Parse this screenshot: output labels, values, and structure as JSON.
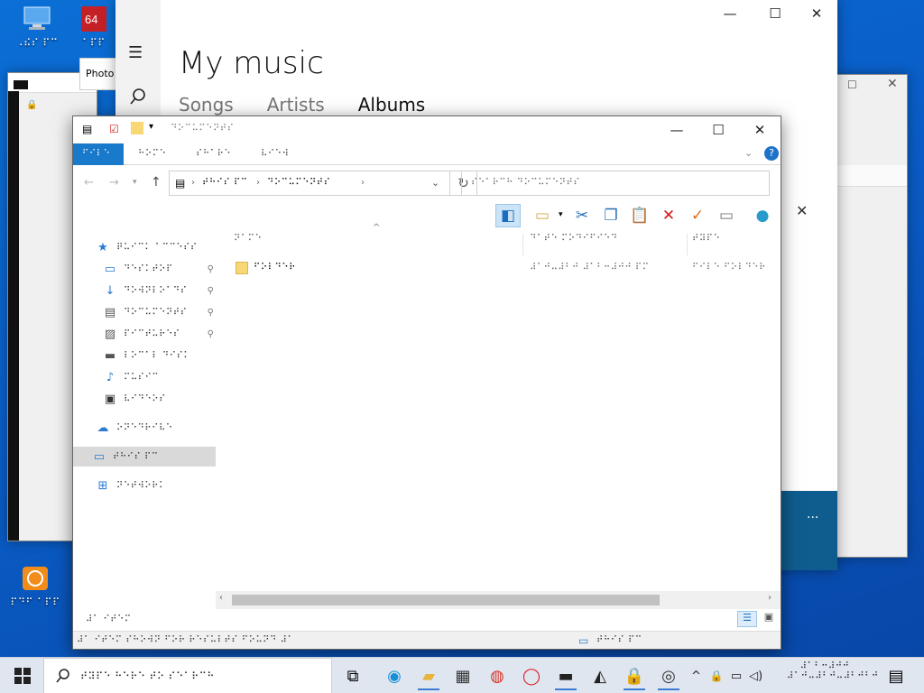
{
  "desktop": {
    "icons": [
      {
        "name": "this-pc",
        "label": "⠠⠮⠎ ⠏⠉"
      },
      {
        "name": "app-64",
        "label": "⠁⠏⠏"
      },
      {
        "name": "pdf-app",
        "label": "⠏⠙⠋ ⠁⠏⠏"
      }
    ]
  },
  "back_window_left": {
    "title": "Photo",
    "label": "⠏⠓⠕⠞⠕",
    "bottom": "⠼⠁ ⠊⠞"
  },
  "music_app": {
    "title": "My music",
    "tabs": [
      {
        "label": "Songs",
        "selected": false
      },
      {
        "label": "Artists",
        "selected": false
      },
      {
        "label": "Albums",
        "selected": true
      }
    ],
    "more_label": "···"
  },
  "explorer": {
    "title": "⠙⠕⠉⠥⠍⠑⠝⠞⠎",
    "ribbon_tabs": [
      "⠋⠊⠇⠑",
      "⠓⠕⠍⠑",
      "⠎⠓⠁⠗⠑",
      "⠧⠊⠑⠺"
    ],
    "address_parts": [
      "⠞⠓⠊⠎ ⠏⠉",
      "⠙⠕⠉⠥⠍⠑⠝⠞⠎"
    ],
    "search_placeholder": "⠎⠑⠁⠗⠉⠓ ⠙⠕⠉⠥⠍⠑⠝⠞⠎",
    "nav_items": [
      {
        "name": "quick-access",
        "icon": "★",
        "label": "⠟⠥⠊⠉⠅ ⠁⠉⠉⠑⠎⠎",
        "pinned": false
      },
      {
        "name": "desktop",
        "icon": "▭",
        "label": "⠙⠑⠎⠅⠞⠕⠏",
        "pinned": true
      },
      {
        "name": "downloads",
        "icon": "↓",
        "label": "⠙⠕⠺⠝⠇⠕⠁⠙⠎",
        "pinned": true
      },
      {
        "name": "documents",
        "icon": "▤",
        "label": "⠙⠕⠉⠥⠍⠑⠝⠞⠎",
        "pinned": true
      },
      {
        "name": "pictures",
        "icon": "▨",
        "label": "⠏⠊⠉⠞⠥⠗⠑⠎",
        "pinned": true
      },
      {
        "name": "local-disk",
        "icon": "▬",
        "label": "⠇⠕⠉⠁⠇ ⠙⠊⠎⠅",
        "pinned": false
      },
      {
        "name": "music",
        "icon": "♪",
        "label": "⠍⠥⠎⠊⠉",
        "pinned": false
      },
      {
        "name": "videos",
        "icon": "▣",
        "label": "⠧⠊⠙⠑⠕⠎",
        "pinned": false
      },
      {
        "name": "onedrive",
        "icon": "☁",
        "label": "⠕⠝⠑⠙⠗⠊⠧⠑",
        "pinned": false
      },
      {
        "name": "this-pc",
        "icon": "▭",
        "label": "⠞⠓⠊⠎ ⠏⠉",
        "pinned": false,
        "selected": true
      },
      {
        "name": "network",
        "icon": "⊞",
        "label": "⠝⠑⠞⠺⠕⠗⠅",
        "pinned": false
      }
    ],
    "columns": [
      "⠝⠁⠍⠑",
      "⠙⠁⠞⠑ ⠍⠕⠙⠊⠋⠊⠑⠙",
      "⠞⠽⠏⠑"
    ],
    "files": [
      {
        "name": "⠋⠕⠇⠙⠑⠗",
        "date": "⠼⠁⠚⠤⠼⠃⠚ ⠼⠁⠃⠒⠼⠚⠚ ⠏⠍",
        "type": "⠋⠊⠇⠑ ⠋⠕⠇⠙⠑⠗"
      }
    ],
    "status_items": "⠼⠁ ⠊⠞⠑⠍",
    "bottom_status": "⠼⠁ ⠊⠞⠑⠍ ⠎⠓⠕⠺⠝ ⠋⠕⠗ ⠗⠑⠎⠥⠇⠞⠎ ⠋⠕⠥⠝⠙ ⠼⠁",
    "bottom_location": "⠞⠓⠊⠎ ⠏⠉"
  },
  "taskbar": {
    "search_text": "⠞⠽⠏⠑ ⠓⠑⠗⠑ ⠞⠕ ⠎⠑⠁⠗⠉⠓",
    "clock_time": "⠼⠁⠃⠒⠼⠚⠚",
    "clock_date": "⠼⠁⠚⠤⠼⠃⠚⠤⠼⠃⠚⠃⠚"
  },
  "colors": {
    "accent": "#1979ca",
    "desktop": "#0a5fc9",
    "taskbar": "#dfe6f0"
  }
}
